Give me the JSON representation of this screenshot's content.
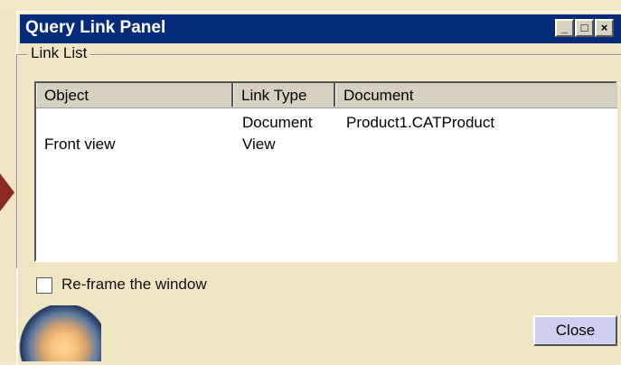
{
  "window": {
    "title": "Query Link Panel"
  },
  "group": {
    "label": "Link List"
  },
  "list": {
    "columns": [
      "Object",
      "Link Type",
      "Document"
    ],
    "rows": [
      {
        "object": "",
        "link_type": "Document",
        "document": "Product1.CATProduct"
      },
      {
        "object": "Front view",
        "link_type": "View",
        "document": ""
      }
    ]
  },
  "options": {
    "reframe_label": "Re-frame the window",
    "reframe_checked": false
  },
  "buttons": {
    "close": "Close"
  },
  "window_controls": {
    "minimize": "_",
    "maximize": "□",
    "close": "×"
  }
}
